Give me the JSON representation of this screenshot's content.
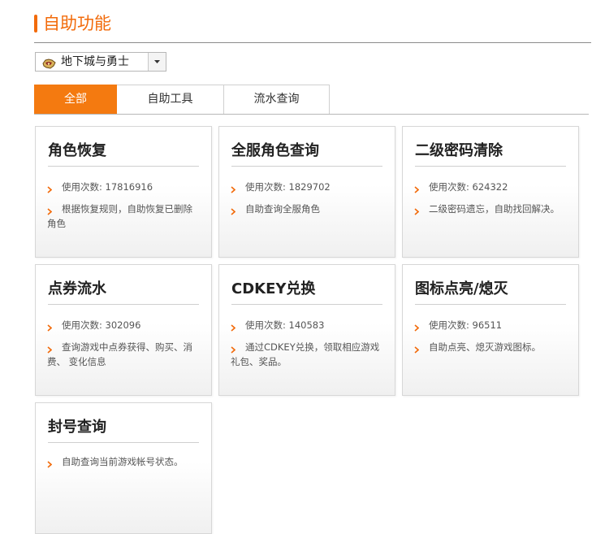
{
  "page": {
    "title": "自助功能",
    "accent_color": "#f26b0b"
  },
  "game_select": {
    "icon": "game-logo-icon",
    "value": "地下城与勇士"
  },
  "tabs": [
    {
      "label": "全部",
      "active": true
    },
    {
      "label": "自助工具",
      "active": false
    },
    {
      "label": "流水查询",
      "active": false
    }
  ],
  "cards": [
    {
      "title": "角色恢复",
      "usage_label": "使用次数:",
      "usage_count": "17816916",
      "desc": "根据恢复规则，自助恢复已删除角色"
    },
    {
      "title": "全服角色查询",
      "usage_label": "使用次数:",
      "usage_count": "1829702",
      "desc": "自助查询全服角色"
    },
    {
      "title": "二级密码清除",
      "usage_label": "使用次数:",
      "usage_count": "624322",
      "desc": "二级密码遗忘，自助找回解决。"
    },
    {
      "title": "点券流水",
      "usage_label": "使用次数:",
      "usage_count": "302096",
      "desc": "查询游戏中点券获得、购买、消费、 变化信息"
    },
    {
      "title": "CDKEY兑换",
      "usage_label": "使用次数:",
      "usage_count": "140583",
      "desc": "通过CDKEY兑换，领取相应游戏礼包、奖品。"
    },
    {
      "title": "图标点亮/熄灭",
      "usage_label": "使用次数:",
      "usage_count": "96511",
      "desc": "自助点亮、熄灭游戏图标。"
    },
    {
      "title": "封号查询",
      "desc": "自助查询当前游戏帐号状态。"
    }
  ]
}
